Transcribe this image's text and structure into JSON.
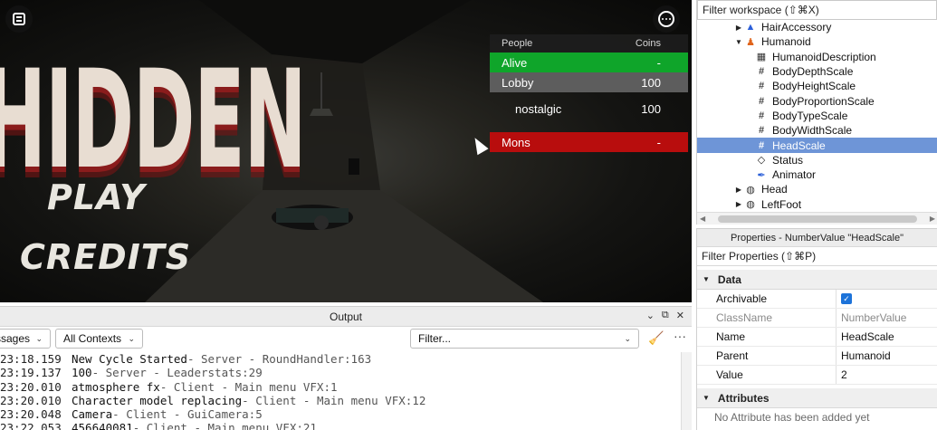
{
  "game": {
    "title_text": "HIDDEN",
    "menu_play": "PLAY",
    "menu_credits": "CREDITS",
    "menu_icon": "menu-icon",
    "more_icon": "more-options-icon"
  },
  "leaderboard": {
    "header_people": "People",
    "header_coins": "Coins",
    "rows": [
      {
        "name": "Alive",
        "value": "-",
        "color": "#0fa52a"
      },
      {
        "name": "Lobby",
        "value": "100",
        "color": "#5d5d5d"
      },
      {
        "name": "nostalgic",
        "value": "100",
        "color": "transparent"
      },
      {
        "name": "Mons",
        "value": "-",
        "color": "#b80d0d"
      }
    ]
  },
  "output": {
    "title": "Output",
    "messages_dropdown": "ssages",
    "contexts_dropdown": "All Contexts",
    "filter_placeholder": "Filter...",
    "logs": [
      {
        "time": "23:18.159",
        "message": "New Cycle Started",
        "source": "  -  Server - RoundHandler:163"
      },
      {
        "time": "23:19.137",
        "message": "100",
        "source": "  -  Server - Leaderstats:29"
      },
      {
        "time": "23:20.010",
        "message": "atmosphere fx",
        "source": "  -  Client - Main menu VFX:1"
      },
      {
        "time": "23:20.010",
        "message": "Character model replacing",
        "source": "  -  Client - Main menu VFX:12"
      },
      {
        "time": "23:20.048",
        "message": "Camera",
        "source": "  -  Client - GuiCamera:5"
      },
      {
        "time": "23:22.053",
        "message": "456640081",
        "source": "  -  Client - Main menu VFX:21"
      }
    ]
  },
  "explorer": {
    "filter_text": "Filter workspace (⇧⌘X)",
    "items": [
      {
        "label": "HairAccessory",
        "indent": 1,
        "arrow": "▶",
        "icon": "hair-accessory-icon",
        "glyph": "▲",
        "color": "#2b5fd9",
        "selected": false
      },
      {
        "label": "Humanoid",
        "indent": 1,
        "arrow": "▼",
        "icon": "humanoid-icon",
        "glyph": "♟",
        "color": "#e0641b",
        "selected": false
      },
      {
        "label": "HumanoidDescription",
        "indent": 2,
        "arrow": "",
        "icon": "humanoid-description-icon",
        "glyph": "▦",
        "color": "#333333",
        "selected": false
      },
      {
        "label": "BodyDepthScale",
        "indent": 2,
        "arrow": "",
        "icon": "number-value-icon",
        "glyph": "#",
        "color": "#444444",
        "selected": false
      },
      {
        "label": "BodyHeightScale",
        "indent": 2,
        "arrow": "",
        "icon": "number-value-icon",
        "glyph": "#",
        "color": "#444444",
        "selected": false
      },
      {
        "label": "BodyProportionScale",
        "indent": 2,
        "arrow": "",
        "icon": "number-value-icon",
        "glyph": "#",
        "color": "#444444",
        "selected": false
      },
      {
        "label": "BodyTypeScale",
        "indent": 2,
        "arrow": "",
        "icon": "number-value-icon",
        "glyph": "#",
        "color": "#444444",
        "selected": false
      },
      {
        "label": "BodyWidthScale",
        "indent": 2,
        "arrow": "",
        "icon": "number-value-icon",
        "glyph": "#",
        "color": "#444444",
        "selected": false
      },
      {
        "label": "HeadScale",
        "indent": 2,
        "arrow": "",
        "icon": "number-value-icon",
        "glyph": "#",
        "color": "#ffffff",
        "selected": true
      },
      {
        "label": "Status",
        "indent": 2,
        "arrow": "",
        "icon": "status-icon",
        "glyph": "◇",
        "color": "#222222",
        "selected": false
      },
      {
        "label": "Animator",
        "indent": 2,
        "arrow": "",
        "icon": "animator-icon",
        "glyph": "✒",
        "color": "#2b5fd9",
        "selected": false
      },
      {
        "label": "Head",
        "indent": 1,
        "arrow": "▶",
        "icon": "mesh-part-icon",
        "glyph": "◍",
        "color": "#333333",
        "selected": false
      },
      {
        "label": "LeftFoot",
        "indent": 1,
        "arrow": "▶",
        "icon": "mesh-part-icon",
        "glyph": "◍",
        "color": "#333333",
        "selected": false
      }
    ]
  },
  "properties": {
    "title": "Properties - NumberValue \"HeadScale\"",
    "filter_text": "Filter Properties (⇧⌘P)",
    "section_data": "Data",
    "rows": [
      {
        "name": "Archivable",
        "value": "",
        "type": "checkbox",
        "checked": true,
        "muted": false
      },
      {
        "name": "ClassName",
        "value": "NumberValue",
        "type": "text",
        "muted": true
      },
      {
        "name": "Name",
        "value": "HeadScale",
        "type": "text",
        "muted": false
      },
      {
        "name": "Parent",
        "value": "Humanoid",
        "type": "text",
        "muted": false
      },
      {
        "name": "Value",
        "value": "2",
        "type": "text",
        "muted": false
      }
    ],
    "section_attributes": "Attributes",
    "no_attributes": "No Attribute has been added yet"
  }
}
